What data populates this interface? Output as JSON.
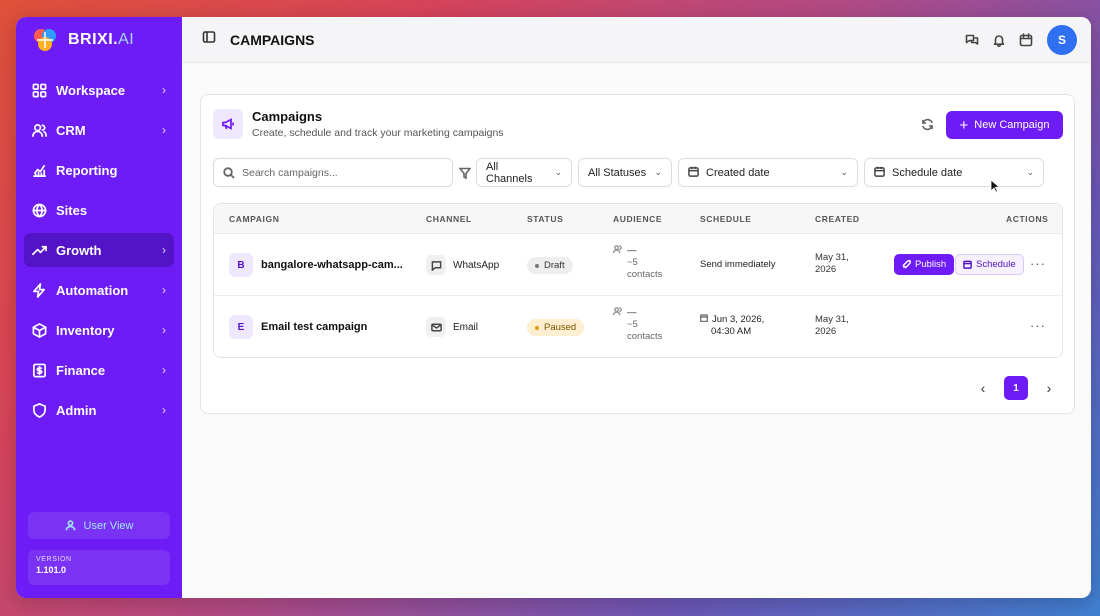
{
  "brand": {
    "name": "BRIXI.",
    "suffix": "AI"
  },
  "sidebar": {
    "items": [
      {
        "label": "Workspace",
        "icon": "grid-icon"
      },
      {
        "label": "CRM",
        "icon": "users-icon"
      },
      {
        "label": "Reporting",
        "icon": "chart-icon"
      },
      {
        "label": "Sites",
        "icon": "globe-icon"
      },
      {
        "label": "Growth",
        "icon": "trending-icon"
      },
      {
        "label": "Automation",
        "icon": "bolt-icon"
      },
      {
        "label": "Inventory",
        "icon": "box-icon"
      },
      {
        "label": "Finance",
        "icon": "dollar-icon"
      },
      {
        "label": "Admin",
        "icon": "shield-icon"
      }
    ],
    "user_view": "User View",
    "version_label": "VERSION",
    "version": "1.101.0"
  },
  "topbar": {
    "title": "CAMPAIGNS",
    "avatar_initial": "S"
  },
  "card": {
    "title": "Campaigns",
    "subtitle": "Create, schedule and track your marketing campaigns",
    "new_button": "New Campaign"
  },
  "filters": {
    "search_placeholder": "Search campaigns...",
    "channels": "All Channels",
    "statuses": "All Statuses",
    "created": "Created date",
    "schedule": "Schedule date"
  },
  "table": {
    "headers": [
      "CAMPAIGN",
      "CHANNEL",
      "STATUS",
      "AUDIENCE",
      "SCHEDULE",
      "CREATED",
      "ACTIONS"
    ],
    "rows": [
      {
        "letter": "B",
        "name": "bangalore-whatsapp-cam...",
        "channel": "WhatsApp",
        "status": "Draft",
        "audience_dash": "—",
        "audience_count": "~5",
        "audience_unit": "contacts",
        "schedule_line1": "Send immediately",
        "schedule_line2": "",
        "created_line1": "May 31,",
        "created_line2": "2026",
        "publish": "Publish",
        "schedule_btn": "Schedule"
      },
      {
        "letter": "E",
        "name": "Email test campaign",
        "channel": "Email",
        "status": "Paused",
        "audience_dash": "—",
        "audience_count": "~5",
        "audience_unit": "contacts",
        "schedule_line1": "Jun 3, 2026,",
        "schedule_line2": "04:30 AM",
        "created_line1": "May 31,",
        "created_line2": "2026"
      }
    ]
  },
  "pagination": {
    "current": "1"
  },
  "colors": {
    "primary": "#6d1cf5",
    "sidebar": "#6d1cf5",
    "avatar": "#2f6ff2"
  }
}
